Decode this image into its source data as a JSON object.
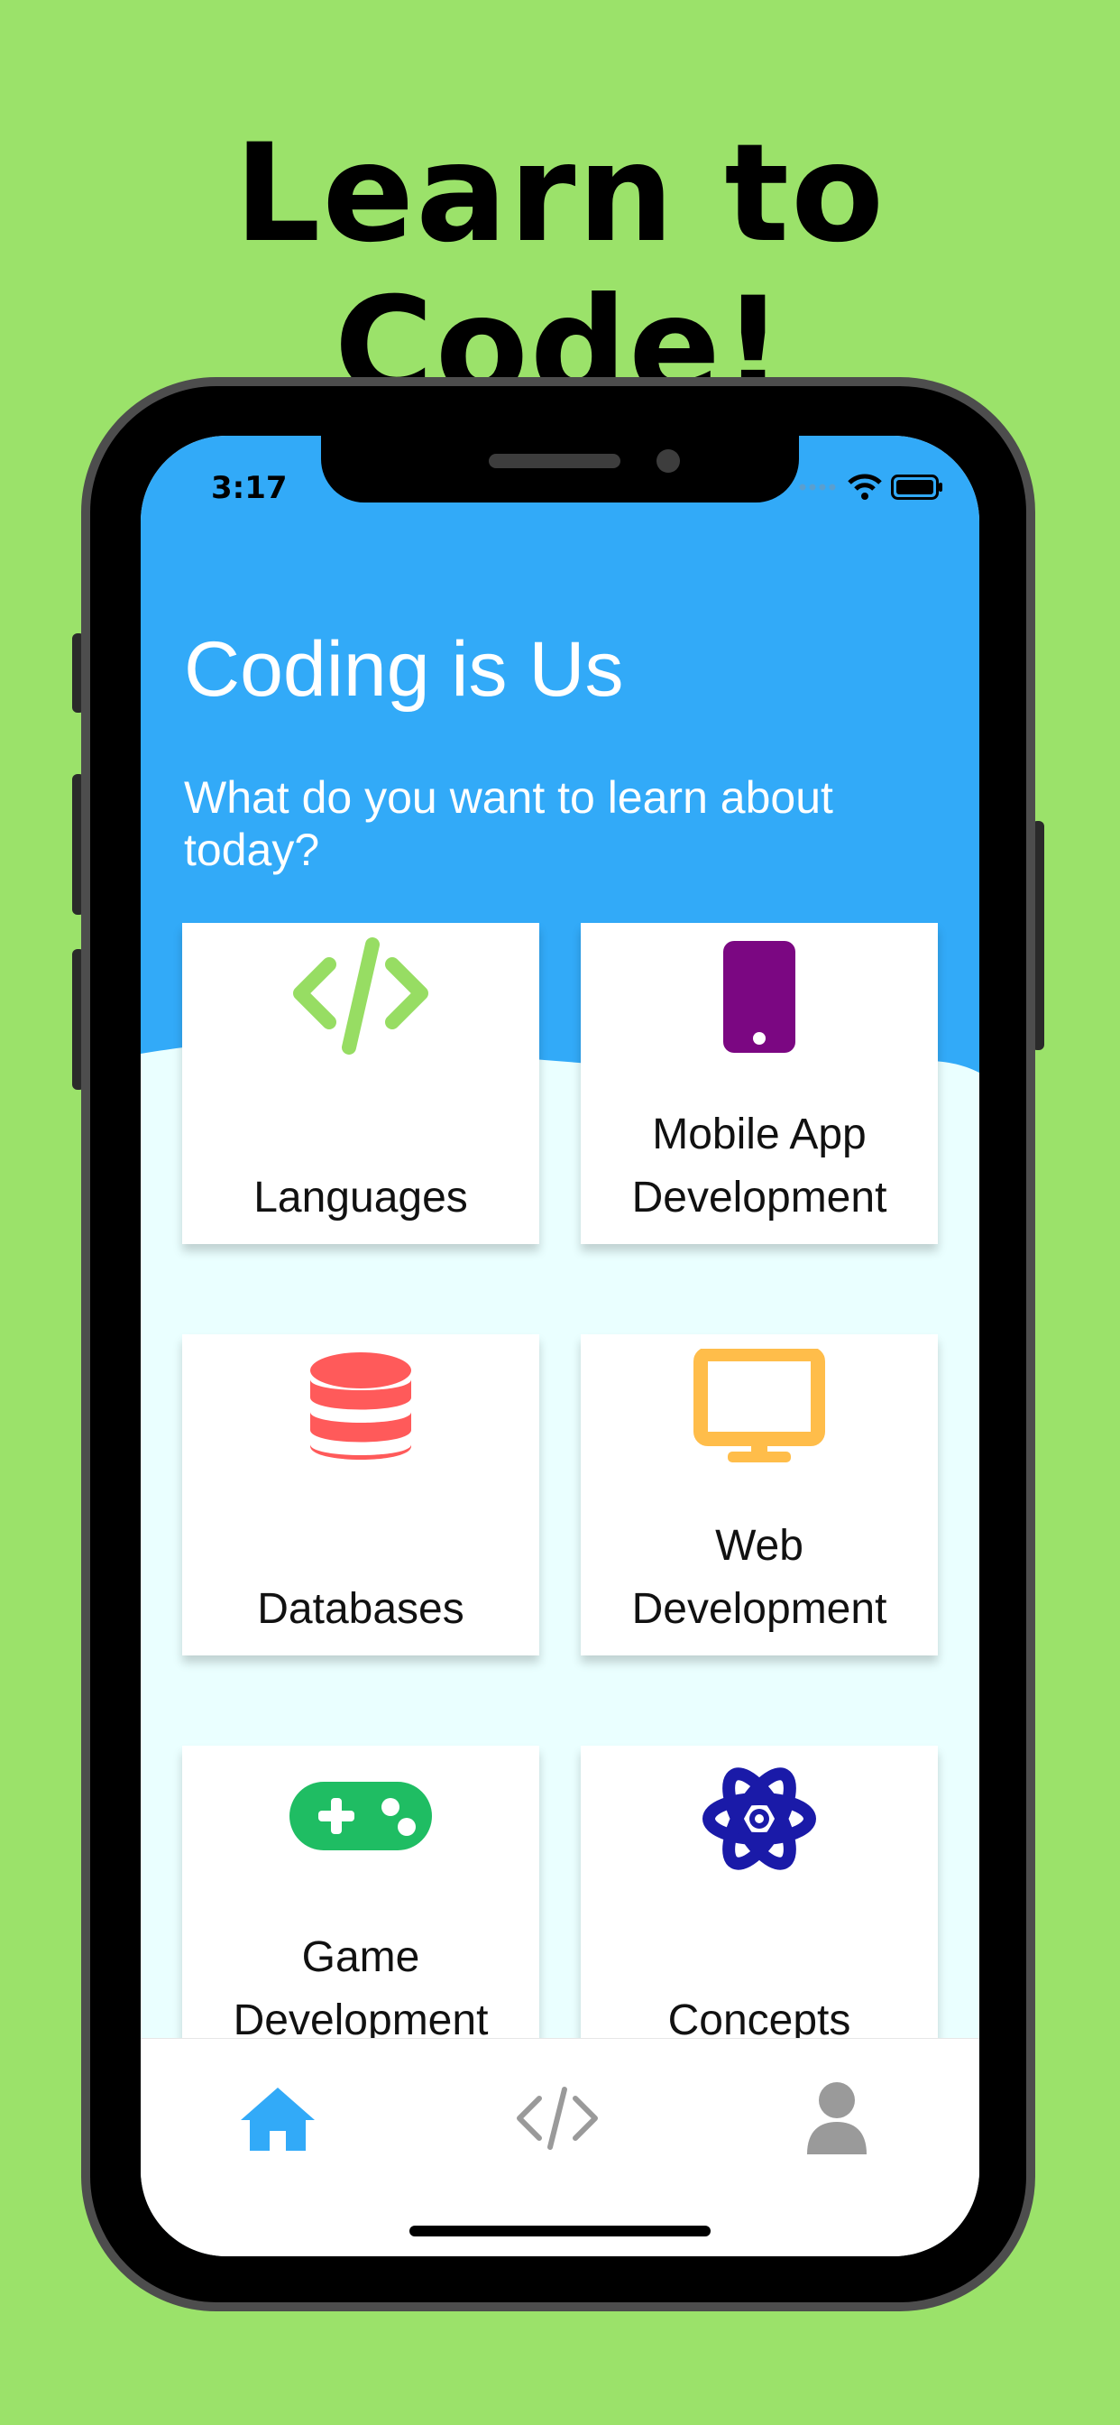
{
  "headline": "Learn to Code!",
  "status_bar": {
    "time": "3:17"
  },
  "app": {
    "title": "Coding is Us",
    "subtitle": "What do you want to learn about today?",
    "colors": {
      "header": "#32aaf8",
      "content_bg": "#eaffff",
      "active_tab": "#32aaf8",
      "inactive_tab": "#9a9a9a"
    }
  },
  "categories": [
    {
      "label": "Languages",
      "icon": "code-icon",
      "color": "#97dd63"
    },
    {
      "label": "Mobile App\nDevelopment",
      "icon": "mobile-phone-icon",
      "color": "#7b0782"
    },
    {
      "label": "Databases",
      "icon": "database-icon",
      "color": "#ff5a5a"
    },
    {
      "label": "Web\nDevelopment",
      "icon": "desktop-monitor-icon",
      "color": "#ffbd4a"
    },
    {
      "label": "Game\nDevelopment",
      "icon": "gamepad-icon",
      "color": "#1fbd63"
    },
    {
      "label": "Concepts",
      "icon": "atom-icon",
      "color": "#1a1aa8"
    }
  ],
  "tabbar": {
    "tabs": [
      {
        "icon": "home-icon",
        "active": true
      },
      {
        "icon": "code-icon",
        "active": false
      },
      {
        "icon": "user-icon",
        "active": false
      }
    ]
  }
}
